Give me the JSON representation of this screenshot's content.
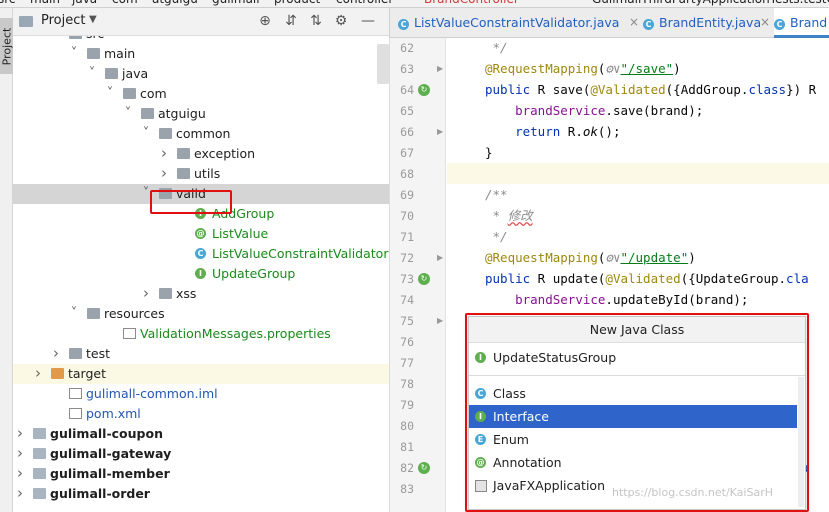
{
  "breadcrumb": [
    "src",
    "main",
    "java",
    "com",
    "atguigu",
    "gulimall",
    "product",
    "controller",
    "BrandController",
    "GulimallThirdPartyApplicationTests.testO"
  ],
  "sidebar_tab": "Project",
  "project_panel": {
    "title": "Project"
  },
  "tree": [
    {
      "label": "src",
      "indent": 56,
      "arrow": "down",
      "icon": "folder",
      "style": "normal"
    },
    {
      "label": "main",
      "indent": 74,
      "arrow": "down",
      "icon": "folder",
      "style": "normal"
    },
    {
      "label": "java",
      "indent": 92,
      "arrow": "down",
      "icon": "folder-blue",
      "style": "normal"
    },
    {
      "label": "com",
      "indent": 110,
      "arrow": "down",
      "icon": "folder",
      "style": "normal"
    },
    {
      "label": "atguigu",
      "indent": 128,
      "arrow": "down",
      "icon": "folder",
      "style": "normal"
    },
    {
      "label": "common",
      "indent": 146,
      "arrow": "down",
      "icon": "folder",
      "style": "normal"
    },
    {
      "label": "exception",
      "indent": 164,
      "arrow": "right",
      "icon": "folder",
      "style": "normal"
    },
    {
      "label": "utils",
      "indent": 164,
      "arrow": "right",
      "icon": "folder",
      "style": "normal"
    },
    {
      "label": "valid",
      "indent": 146,
      "arrow": "down",
      "icon": "folder",
      "style": "normal",
      "selected": true
    },
    {
      "label": "AddGroup",
      "indent": 182,
      "icon": "interface",
      "style": "green"
    },
    {
      "label": "ListValue",
      "indent": 182,
      "icon": "annotation",
      "style": "green"
    },
    {
      "label": "ListValueConstraintValidator",
      "indent": 182,
      "icon": "class",
      "style": "green"
    },
    {
      "label": "UpdateGroup",
      "indent": 182,
      "icon": "interface",
      "style": "green"
    },
    {
      "label": "xss",
      "indent": 146,
      "arrow": "right",
      "icon": "folder",
      "style": "normal"
    },
    {
      "label": "resources",
      "indent": 74,
      "arrow": "down",
      "icon": "folder-res",
      "style": "normal"
    },
    {
      "label": "ValidationMessages.properties",
      "indent": 110,
      "icon": "properties",
      "style": "green"
    },
    {
      "label": "test",
      "indent": 56,
      "arrow": "right",
      "icon": "folder",
      "style": "normal"
    },
    {
      "label": "target",
      "indent": 38,
      "arrow": "right",
      "icon": "folder-orange",
      "style": "normal",
      "target": true
    },
    {
      "label": "gulimall-common.iml",
      "indent": 56,
      "icon": "iml",
      "style": "blue"
    },
    {
      "label": "pom.xml",
      "indent": 56,
      "icon": "pom",
      "style": "blue"
    },
    {
      "label": "gulimall-coupon",
      "indent": 20,
      "arrow": "right",
      "icon": "module",
      "style": "bold"
    },
    {
      "label": "gulimall-gateway",
      "indent": 20,
      "arrow": "right",
      "icon": "module",
      "style": "bold"
    },
    {
      "label": "gulimall-member",
      "indent": 20,
      "arrow": "right",
      "icon": "module",
      "style": "bold"
    },
    {
      "label": "gulimall-order",
      "indent": 20,
      "arrow": "right",
      "icon": "module",
      "style": "bold"
    }
  ],
  "tabs": [
    {
      "name": "ListValueConstraintValidator.java",
      "icon": "C",
      "active": false
    },
    {
      "name": "BrandEntity.java",
      "icon": "C",
      "active": false
    },
    {
      "name": "Brand",
      "icon": "C",
      "active": true
    }
  ],
  "code": [
    {
      "ln": "62",
      "html": "<span class='cmt'> */</span>"
    },
    {
      "ln": "63",
      "html": "<span class='ann'>@RequestMapping</span>(<span class='cmt'>&#9881;&#8744;</span><span class='str'>\"/save\"</span>)"
    },
    {
      "ln": "64",
      "html": "<span class='kw'>public</span> R save(<span class='ann'>@Validated</span>({AddGroup.<span class='kw'>class</span>}) R",
      "gicon": true
    },
    {
      "ln": "65",
      "html": "    <span class='fld'>brandService</span>.save(brand);"
    },
    {
      "ln": "66",
      "html": "    <span class='kw'>return</span> R.<span class='ital'>ok</span>();"
    },
    {
      "ln": "67",
      "html": "}"
    },
    {
      "ln": "68",
      "html": "",
      "cur": true
    },
    {
      "ln": "69",
      "html": "<span class='cmt'>/**</span>"
    },
    {
      "ln": "70",
      "html": "<span class='cmt'> * <span class='wavy'>修改</span></span>"
    },
    {
      "ln": "71",
      "html": "<span class='cmt'> */</span>"
    },
    {
      "ln": "72",
      "html": "<span class='ann'>@RequestMapping</span>(<span class='cmt'>&#9881;&#8744;</span><span class='str'>\"/update\"</span>)"
    },
    {
      "ln": "73",
      "html": "<span class='kw'>public</span> R update(<span class='ann'>@Validated</span>({UpdateGroup.<span class='kw'>cla</span>",
      "gicon": true
    },
    {
      "ln": "74",
      "html": "    <span class='fld'>brandService</span>.updateById(brand);"
    },
    {
      "ln": "75",
      "html": ""
    },
    {
      "ln": "76",
      "html": ""
    },
    {
      "ln": "77",
      "html": ""
    },
    {
      "ln": "78",
      "html": ""
    },
    {
      "ln": "79",
      "html": ""
    },
    {
      "ln": "80",
      "html": ""
    },
    {
      "ln": "81",
      "html": ""
    },
    {
      "ln": "82",
      "html": "                                        <span class='kw'>cla</span>",
      "gicon": true
    },
    {
      "ln": "83",
      "html": ""
    }
  ],
  "new_class_dialog": {
    "title": "New Java Class",
    "name_value": "UpdateStatusGroup",
    "kinds": [
      {
        "label": "Class",
        "icon": "C",
        "selected": false
      },
      {
        "label": "Interface",
        "icon": "I",
        "selected": true
      },
      {
        "label": "Enum",
        "icon": "E",
        "selected": false
      },
      {
        "label": "Annotation",
        "icon": "@",
        "selected": false
      },
      {
        "label": "JavaFXApplication",
        "icon": "jfx",
        "selected": false
      }
    ]
  },
  "watermark": "https://blog.csdn.net/KaiSarH"
}
